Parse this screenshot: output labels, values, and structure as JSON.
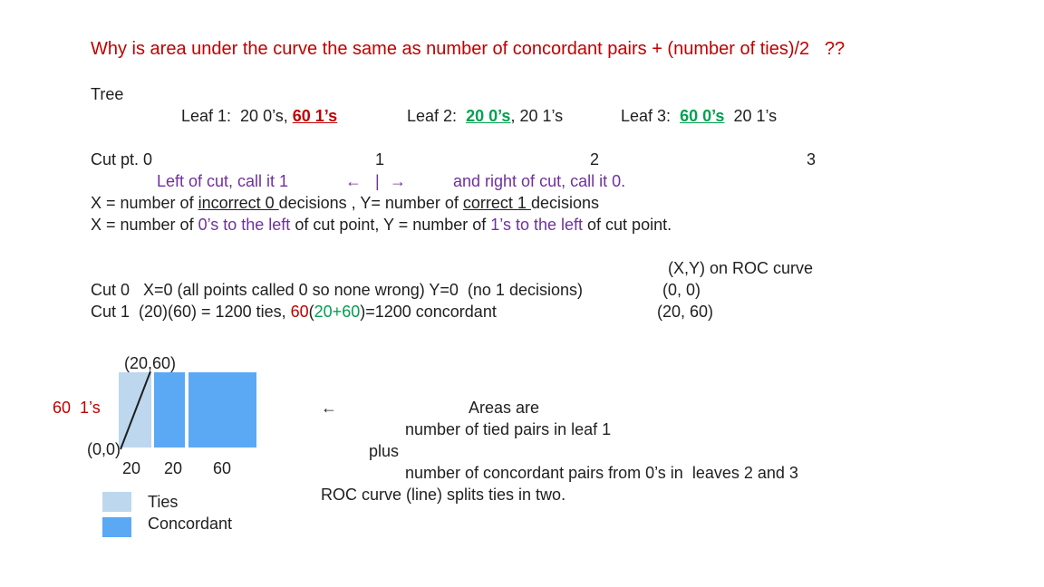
{
  "title": "Why is area under the curve the same as number of concordant pairs + (number of ties)/2   ??",
  "tree_label": "Tree",
  "leaves": {
    "leaf1": {
      "prefix": "Leaf 1:  20 0’s, ",
      "ones": "60 1’s"
    },
    "leaf2": {
      "prefix": "Leaf 2:  ",
      "zeros": "20 0’s",
      "suffix": ", 20 1’s"
    },
    "leaf3": {
      "prefix": "Leaf 3:  ",
      "zeros": "60 0’s",
      "suffix": "  20 1’s"
    }
  },
  "cut_points": {
    "label": "Cut pt. 0",
    "p1": "1",
    "p2": "2",
    "p3": "3"
  },
  "cut_rule": {
    "left": "Left of cut, call it 1",
    "arrow_left": "←",
    "bar": "|",
    "arrow_right": "→",
    "right": "and right of cut, call it 0."
  },
  "def1": {
    "a": "X = number of ",
    "b": "incorrect 0 ",
    "c": "decisions , Y= number of ",
    "d": "correct 1 ",
    "e": "decisions"
  },
  "def2": {
    "a": "X = number of ",
    "b": "0’s to the left ",
    "c": "of cut point, Y = number of ",
    "d": "1’s to the left ",
    "e": "of cut point."
  },
  "roc_header": "(X,Y) on ROC curve",
  "cut0": {
    "text": "Cut 0   X=0 (all points called 0 so none wrong) Y=0  (no 1 decisions)",
    "roc": "(0, 0)"
  },
  "cut1": {
    "a": "Cut 1  (20)(60) = 1200 ties, ",
    "b": "60",
    "c": "(",
    "d": "20+60",
    "e": ")=1200 concordant",
    "roc": "(20, 60)"
  },
  "diagram": {
    "top_label": "(20,60)",
    "y_label": "60  1’s",
    "origin_label": "(0,0)",
    "x_labels": [
      "20",
      "20",
      "60"
    ],
    "colors": {
      "ties": "#bdd7ee",
      "concordant": "#5ba8f5"
    }
  },
  "legend": [
    {
      "label": "Ties",
      "color": "#bdd7ee"
    },
    {
      "label": "Concordant",
      "color": "#5ba8f5"
    }
  ],
  "explanation": {
    "arrow": "←",
    "line1": "Areas are",
    "line2": "number of tied pairs in leaf 1",
    "line3": "plus",
    "line4": "number of concordant pairs from 0’s in  leaves 2 and 3",
    "line5": "ROC curve (line) splits ties in two."
  }
}
